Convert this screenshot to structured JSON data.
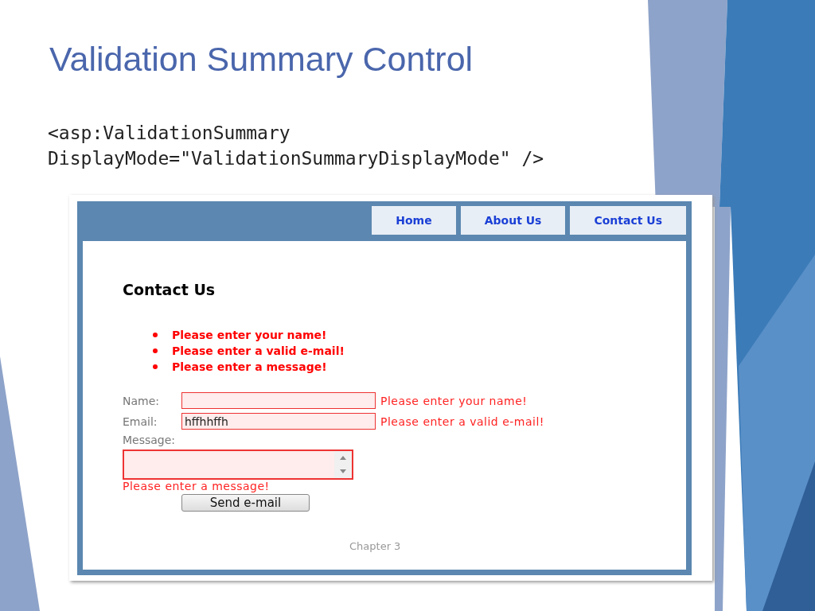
{
  "slide": {
    "title": "Validation Summary Control",
    "code_lines": [
      "<asp:ValidationSummary",
      "DisplayMode=\"ValidationSummaryDisplayMode\" />"
    ]
  },
  "screenshot": {
    "nav_tabs": [
      {
        "label": "Home"
      },
      {
        "label": "About Us"
      },
      {
        "label": "Contact Us"
      }
    ],
    "heading": "Contact Us",
    "summary_errors": [
      "Please enter your name!",
      "Please enter a valid e-mail!",
      "Please enter a message!"
    ],
    "fields": [
      {
        "kind": "inline",
        "label": "Name:",
        "error": "Please enter your name!"
      },
      {
        "kind": "inline",
        "label": "Email:",
        "value": "hffhhffh",
        "error": "Please enter a valid e-mail!"
      },
      {
        "kind": "textarea",
        "label": "Message:",
        "error": "Please enter a message!"
      }
    ],
    "button": "Send e-mail",
    "footer": "Chapter 3"
  }
}
